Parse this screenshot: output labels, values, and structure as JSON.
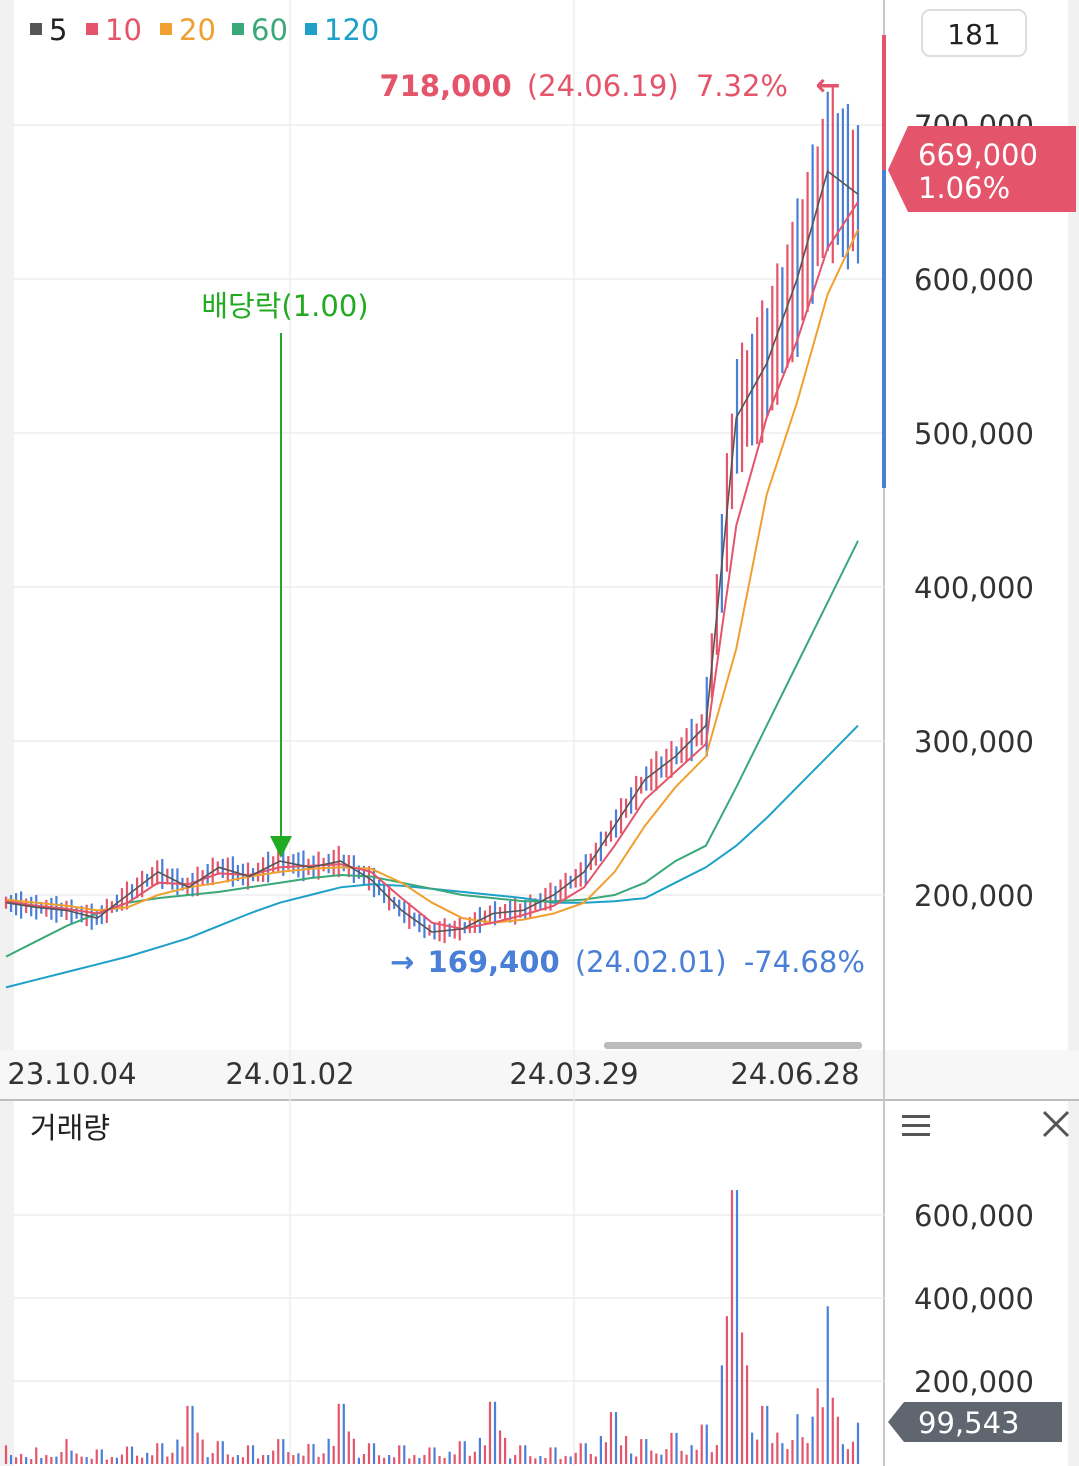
{
  "legend": [
    {
      "label": "5",
      "color": "#555555"
    },
    {
      "label": "10",
      "color": "#e4546a"
    },
    {
      "label": "20",
      "color": "#f0a030"
    },
    {
      "label": "60",
      "color": "#3aa878"
    },
    {
      "label": "120",
      "color": "#1ea0c8"
    }
  ],
  "period_box": "181",
  "high_annotation": {
    "price": "718,000",
    "date": "(24.06.19)",
    "pct": "7.32%",
    "arrow": "←"
  },
  "low_annotation": {
    "arrow": "→",
    "price": "169,400",
    "date": "(24.02.01)",
    "pct": "-74.68%"
  },
  "dividend_annotation": "배당락(1.00)",
  "current_price": {
    "price": "669,000",
    "pct": "1.06%"
  },
  "current_volume": "99,543",
  "x_tick_labels": [
    "23.10.04",
    "24.01.02",
    "24.03.29",
    "24.06.28"
  ],
  "price_axis_labels": [
    "700,000",
    "600,000",
    "500,000",
    "400,000",
    "300,000",
    "200,000"
  ],
  "volume_panel": {
    "title": "거래량",
    "menu_icon": "menu-icon",
    "close_icon": "close-icon"
  },
  "volume_axis_labels": [
    "600,000",
    "400,000",
    "200,000"
  ],
  "colors": {
    "up": "#e4546a",
    "down": "#4a7fd8",
    "dividend": "#22aa22",
    "high": "#e4546a",
    "low": "#4a7fd8",
    "volume_badge": "#5f6670"
  },
  "chart_data": [
    {
      "type": "line",
      "chart_kind": "candlestick with moving averages",
      "date_ticks": [
        "23.10.04",
        "24.01.02",
        "24.03.29",
        "24.06.28"
      ],
      "ylim": [
        100000,
        740000
      ],
      "y_ticks": [
        200000,
        300000,
        400000,
        500000,
        600000,
        700000
      ],
      "grid": true,
      "legend": "top-left",
      "series": [
        {
          "name": "5",
          "values": [
            195000,
            192000,
            190000,
            185000,
            200000,
            215000,
            205000,
            218000,
            212000,
            222000,
            218000,
            222000,
            210000,
            190000,
            176000,
            178000,
            188000,
            190000,
            200000,
            215000,
            245000,
            275000,
            290000,
            310000,
            510000,
            545000,
            600000,
            670000,
            655000
          ]
        },
        {
          "name": "10",
          "values": [
            196000,
            193000,
            191000,
            188000,
            195000,
            208000,
            207000,
            214000,
            213000,
            218000,
            219000,
            220000,
            215000,
            198000,
            182000,
            178000,
            182000,
            187000,
            193000,
            205000,
            232000,
            262000,
            280000,
            298000,
            440000,
            510000,
            560000,
            620000,
            650000
          ]
        },
        {
          "name": "20",
          "values": [
            197000,
            195000,
            193000,
            190000,
            192000,
            200000,
            205000,
            208000,
            212000,
            215000,
            217000,
            218000,
            217000,
            208000,
            195000,
            185000,
            182000,
            184000,
            188000,
            195000,
            215000,
            245000,
            270000,
            290000,
            360000,
            460000,
            520000,
            590000,
            632000
          ]
        },
        {
          "name": "60",
          "values": [
            160000,
            170000,
            180000,
            188000,
            195000,
            198000,
            200000,
            202000,
            205000,
            208000,
            211000,
            213000,
            212000,
            208000,
            204000,
            200000,
            198000,
            196000,
            196000,
            197000,
            200000,
            208000,
            222000,
            232000,
            270000,
            310000,
            350000,
            390000,
            430000
          ]
        },
        {
          "name": "120",
          "values": [
            140000,
            145000,
            150000,
            155000,
            160000,
            166000,
            172000,
            180000,
            188000,
            195000,
            200000,
            205000,
            207000,
            206000,
            204000,
            202000,
            200000,
            198000,
            195000,
            195000,
            196000,
            198000,
            208000,
            218000,
            232000,
            250000,
            270000,
            290000,
            310000
          ]
        }
      ],
      "annotations": {
        "high": {
          "value": 718000,
          "date": "24.06.19"
        },
        "low": {
          "value": 169400,
          "date": "24.02.01"
        },
        "ex_dividend_date": "24.01.02",
        "current": {
          "value": 669000,
          "change_pct": 1.06
        }
      }
    },
    {
      "type": "bar",
      "title": "거래량",
      "ylim": [
        0,
        740000
      ],
      "y_ticks": [
        200000,
        400000,
        600000
      ],
      "values": [
        45000,
        40000,
        60000,
        35000,
        42000,
        50000,
        140000,
        55000,
        45000,
        60000,
        48000,
        145000,
        50000,
        45000,
        40000,
        55000,
        150000,
        45000,
        40000,
        50000,
        125000,
        60000,
        75000,
        95000,
        660000,
        140000,
        120000,
        380000,
        99543
      ]
    }
  ]
}
